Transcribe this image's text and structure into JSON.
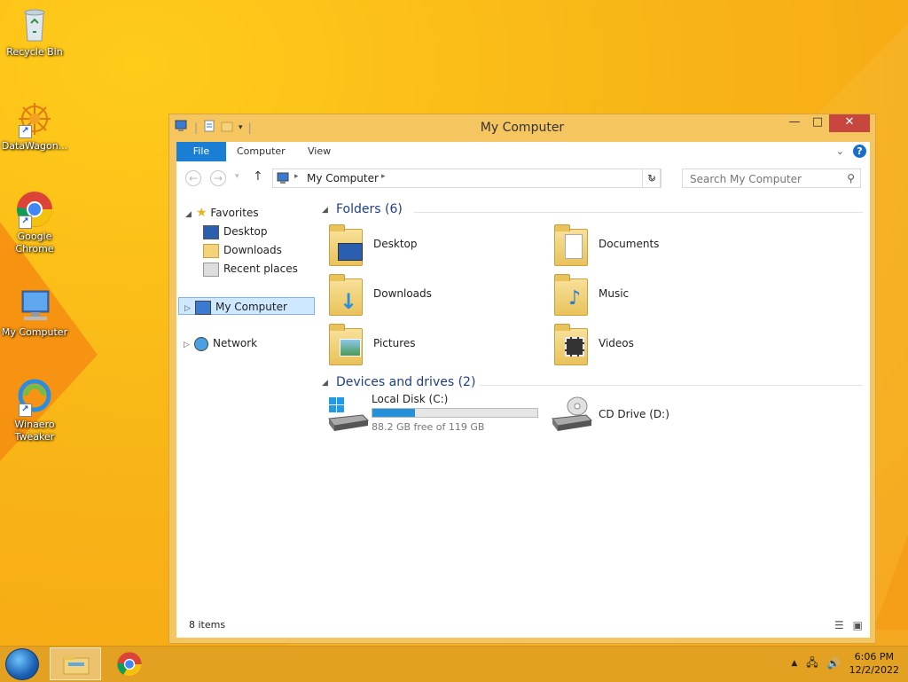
{
  "desktop": {
    "icons": [
      {
        "label": "Recycle Bin",
        "icon": "recycle-bin-icon"
      },
      {
        "label": "DataWagon...",
        "icon": "datawagon-icon"
      },
      {
        "label": "Google Chrome",
        "icon": "chrome-icon"
      },
      {
        "label": "My Computer",
        "icon": "computer-icon"
      },
      {
        "label": "Winaero Tweaker",
        "icon": "winaero-tweaker-icon"
      }
    ]
  },
  "window": {
    "title": "My Computer",
    "controls": {
      "minimize": "—",
      "maximize": "□",
      "close": "✕"
    }
  },
  "ribbon": {
    "tabs": [
      "File",
      "Computer",
      "View"
    ]
  },
  "address": {
    "path": "My Computer",
    "search_placeholder": "Search My Computer"
  },
  "nav_pane": {
    "favorites": "Favorites",
    "favorites_items": [
      "Desktop",
      "Downloads",
      "Recent places"
    ],
    "my_computer": "My Computer",
    "network": "Network"
  },
  "folders": {
    "header": "Folders (6)",
    "items": [
      "Desktop",
      "Documents",
      "Downloads",
      "Music",
      "Pictures",
      "Videos"
    ]
  },
  "devices": {
    "header": "Devices and drives (2)",
    "local_disk": {
      "label": "Local Disk (C:)",
      "free_text": "88.2 GB free of 119 GB",
      "used_fraction": 0.26
    },
    "cd_drive": {
      "label": "CD Drive (D:)"
    }
  },
  "status": {
    "items_count": "8 items"
  },
  "taskbar": {
    "time": "6:06 PM",
    "date": "12/2/2022"
  },
  "colors": {
    "accent": "#1a7fd4",
    "close": "#c7473f",
    "window_frame": "#f5c55f",
    "group_header": "#1e3e8a"
  }
}
